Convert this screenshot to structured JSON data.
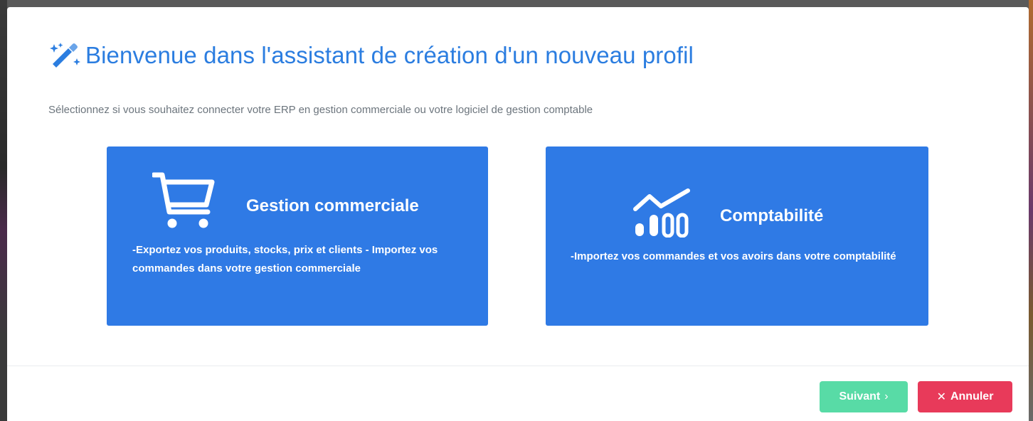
{
  "header": {
    "title": "Bienvenue dans l'assistant de création d'un nouveau profil",
    "icon": "magic-wand-icon"
  },
  "subtitle": "Sélectionnez si vous souhaitez connecter votre ERP en gestion commerciale ou votre logiciel de gestion comptable",
  "options": [
    {
      "title": "Gestion commerciale",
      "icon": "shopping-cart-icon",
      "description": "-Exportez vos produits, stocks, prix et clients - Importez vos commandes dans votre gestion commerciale"
    },
    {
      "title": "Comptabilité",
      "icon": "chart-line-icon",
      "description": "-Importez vos commandes et vos avoirs dans votre comptabilité"
    }
  ],
  "footer": {
    "next_label": "Suivant",
    "next_glyph": "›",
    "cancel_label": "Annuler",
    "cancel_glyph": "✕"
  },
  "colors": {
    "primary": "#2f7ae5",
    "title": "#2b7de0",
    "next": "#58dba6",
    "cancel": "#e83a5a"
  }
}
